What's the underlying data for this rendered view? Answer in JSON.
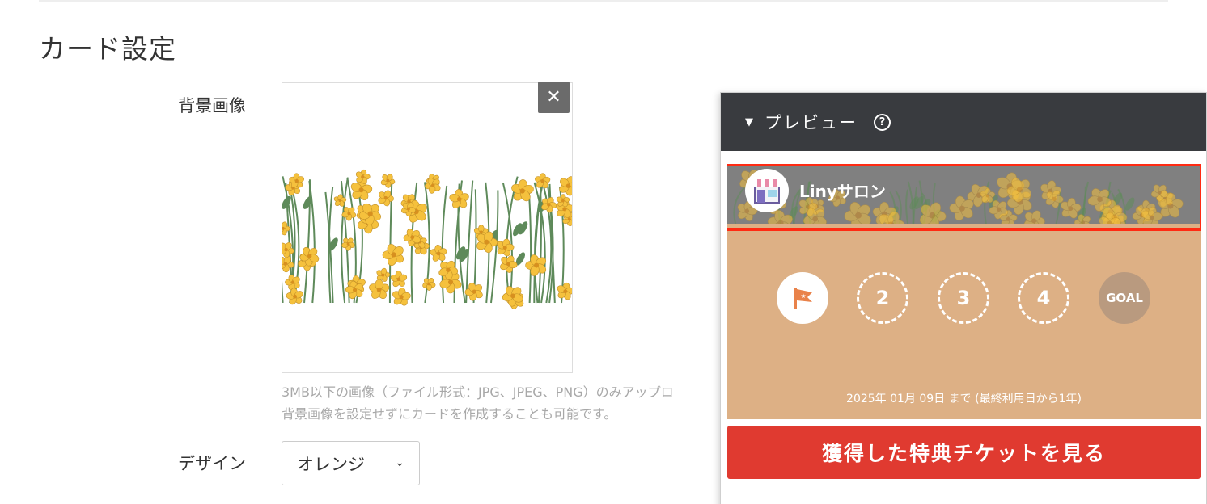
{
  "section": {
    "title": "カード設定"
  },
  "form": {
    "background_label": "背景画像",
    "remove_label": "✕",
    "help_line1": "3MB以下の画像（ファイル形式：JPG、JPEG、PNG）のみアップロ",
    "help_line2": "背景画像を設定せずにカードを作成することも可能です。",
    "design_label": "デザイン",
    "design_value": "オレンジ",
    "design_chevron": "⌄"
  },
  "preview": {
    "caret": "▼",
    "title": "プレビュー",
    "help_mark": "?",
    "shop_name": "Linyサロン",
    "stamps": [
      "2",
      "3",
      "4"
    ],
    "goal_label": "GOAL",
    "expiry": "2025年 01月 09日 まで (最終利用日から1年)",
    "ticket_button": "獲得した特典チケットを見る"
  },
  "colors": {
    "header_bg": "#393b3f",
    "card_bg": "#ddb085",
    "ticket_button": "#e03a30",
    "highlight_border": "#ff2a12",
    "flower": "#f5c13d",
    "flower_center": "#d7901f",
    "leaf": "#5e8a5a"
  },
  "icons": {
    "remove": "close-icon",
    "caret": "caret-down-icon",
    "help": "question-circle-icon",
    "shop": "storefront-icon",
    "start_stamp": "flag-icon"
  }
}
